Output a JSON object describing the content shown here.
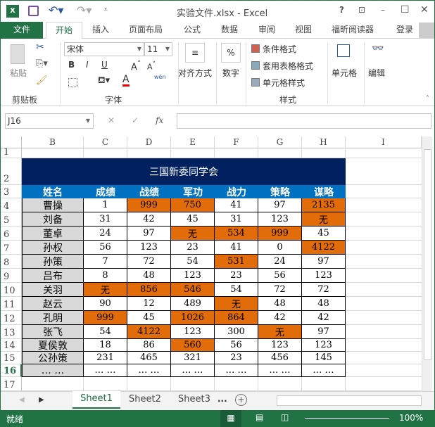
{
  "title": "实验文件.xlsx - Excel",
  "window_buttons": {
    "help": "?",
    "restore_ribbon": "⊡",
    "minimize": "–",
    "maximize": "☐",
    "close": "✕"
  },
  "tabs": [
    "文件",
    "开始",
    "插入",
    "页面布局",
    "公式",
    "数据",
    "审阅",
    "视图",
    "福昕阅读器"
  ],
  "login": "登录",
  "ribbon": {
    "paste": "粘贴",
    "clipboard": "剪贴板",
    "font_name": "宋体",
    "font_size": "11",
    "bold": "B",
    "italic": "I",
    "underline": "U",
    "font_group": "字体",
    "align": "对齐方式",
    "number": "数字",
    "cond_format": "条件格式",
    "table_format": "套用表格格式",
    "cell_style": "单元格样式",
    "styles_group": "样式",
    "cells": "单元格",
    "edit": "编辑",
    "percent": "%",
    "wen": "wén"
  },
  "formula_bar": {
    "name_box": "J16",
    "fx": "fx",
    "value": ""
  },
  "columns": [
    "B",
    "C",
    "D",
    "E",
    "F",
    "G",
    "H",
    "I"
  ],
  "rows": [
    "1",
    "2",
    "3",
    "4",
    "5",
    "6",
    "7",
    "8",
    "9",
    "10",
    "11",
    "12",
    "13",
    "14",
    "15",
    "16",
    "17"
  ],
  "table": {
    "title": "三国新委同学会",
    "headers": [
      "姓名",
      "成绩",
      "战绩",
      "军功",
      "战力",
      "策略",
      "谋略"
    ],
    "data": [
      [
        "曹操",
        "1",
        "999",
        "750",
        "41",
        "97",
        "2135"
      ],
      [
        "刘备",
        "31",
        "42",
        "45",
        "31",
        "123",
        "无"
      ],
      [
        "董卓",
        "24",
        "97",
        "无",
        "534",
        "999",
        "45"
      ],
      [
        "孙权",
        "56",
        "123",
        "23",
        "41",
        "0",
        "4122"
      ],
      [
        "孙策",
        "7",
        "72",
        "54",
        "531",
        "24",
        "97"
      ],
      [
        "吕布",
        "8",
        "48",
        "123",
        "23",
        "56",
        "123"
      ],
      [
        "关羽",
        "无",
        "856",
        "546",
        "54",
        "72",
        "72"
      ],
      [
        "赵云",
        "90",
        "12",
        "489",
        "无",
        "48",
        "48"
      ],
      [
        "孔明",
        "999",
        "45",
        "1026",
        "864",
        "42",
        "42"
      ],
      [
        "张飞",
        "54",
        "4122",
        "123",
        "300",
        "无",
        "97"
      ],
      [
        "夏侯敦",
        "18",
        "86",
        "560",
        "56",
        "123",
        "123"
      ],
      [
        "公孙策",
        "231",
        "465",
        "321",
        "23",
        "456",
        "145"
      ],
      [
        "… …",
        "… …",
        "… …",
        "… …",
        "… …",
        "… …",
        "… …"
      ]
    ],
    "highlight": [
      [
        0,
        0,
        1,
        1,
        0,
        0,
        1
      ],
      [
        0,
        0,
        0,
        0,
        0,
        0,
        1
      ],
      [
        0,
        0,
        0,
        1,
        1,
        1,
        0
      ],
      [
        0,
        0,
        0,
        0,
        0,
        0,
        1
      ],
      [
        0,
        0,
        0,
        0,
        1,
        0,
        0
      ],
      [
        0,
        0,
        0,
        0,
        0,
        0,
        0
      ],
      [
        0,
        1,
        1,
        1,
        0,
        0,
        0
      ],
      [
        0,
        0,
        0,
        0,
        1,
        0,
        0
      ],
      [
        0,
        1,
        0,
        1,
        1,
        0,
        0
      ],
      [
        0,
        0,
        1,
        0,
        0,
        1,
        0
      ],
      [
        0,
        0,
        0,
        1,
        0,
        0,
        0
      ],
      [
        0,
        0,
        0,
        0,
        0,
        0,
        0
      ],
      [
        0,
        0,
        0,
        0,
        0,
        0,
        0
      ]
    ]
  },
  "colors": {
    "title_bg": "#002060",
    "header_bg": "#0070c0",
    "highlight": "#e26b0a",
    "name_bg": "#d9d9d9",
    "excel_green": "#217346"
  },
  "sheets": [
    "Sheet1",
    "Sheet2",
    "Sheet3",
    "..."
  ],
  "status": {
    "ready": "就绪",
    "zoom": "100%"
  }
}
